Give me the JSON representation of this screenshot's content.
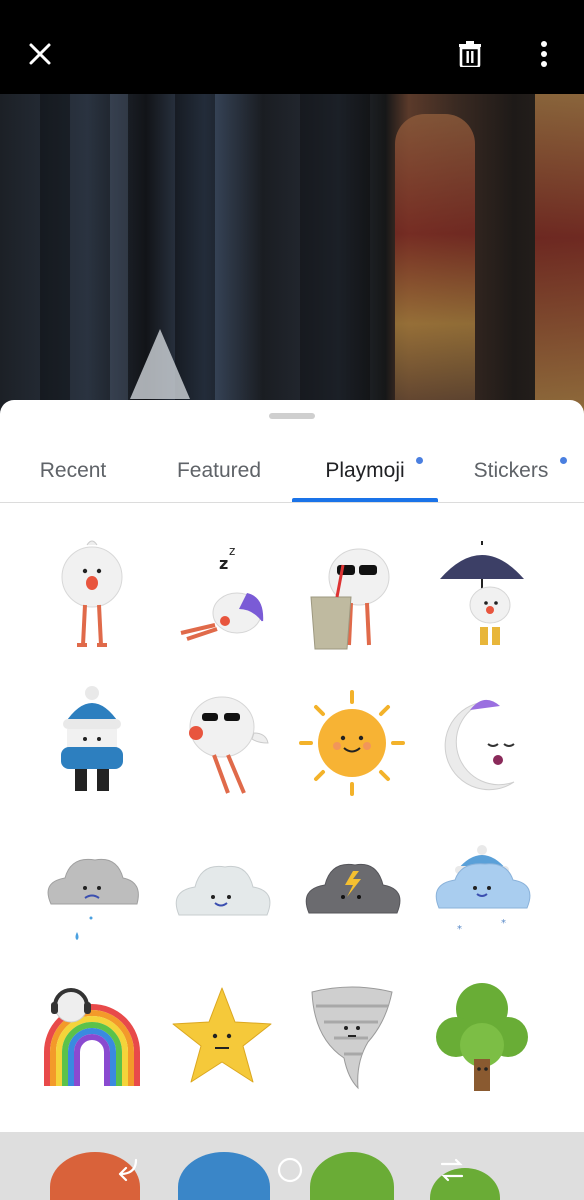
{
  "topbar": {
    "close_icon": "close-icon",
    "trash_icon": "trash-icon",
    "more_icon": "more-vert-icon"
  },
  "tabs": [
    {
      "label": "Recent",
      "active": false,
      "dot": false
    },
    {
      "label": "Featured",
      "active": false,
      "dot": false
    },
    {
      "label": "Playmoji",
      "active": true,
      "dot": true
    },
    {
      "label": "Stickers",
      "active": false,
      "dot": true
    }
  ],
  "colors": {
    "accent": "#1a73e8",
    "dot": "#4a7fe0",
    "tab_text": "#5f6368",
    "tab_text_active": "#202124",
    "navbar": "#dedede"
  },
  "stickers": [
    "round-bird-sticker",
    "sleeping-bird-sticker",
    "sunglasses-bird-with-cup-sticker",
    "umbrella-bird-sticker",
    "winter-hat-bird-sticker",
    "sunglasses-bird-sticker",
    "smiling-sun-sticker",
    "sleepy-moon-sticker",
    "sad-rain-cloud-sticker",
    "happy-cloud-sticker",
    "storm-cloud-sticker",
    "snow-cloud-sticker",
    "rainbow-with-headphones-sticker",
    "smiling-star-sticker",
    "tornado-sticker",
    "green-tree-sticker"
  ],
  "navbar": {
    "back_icon": "back-icon",
    "home_icon": "home-icon",
    "recents_icon": "recents-icon"
  }
}
